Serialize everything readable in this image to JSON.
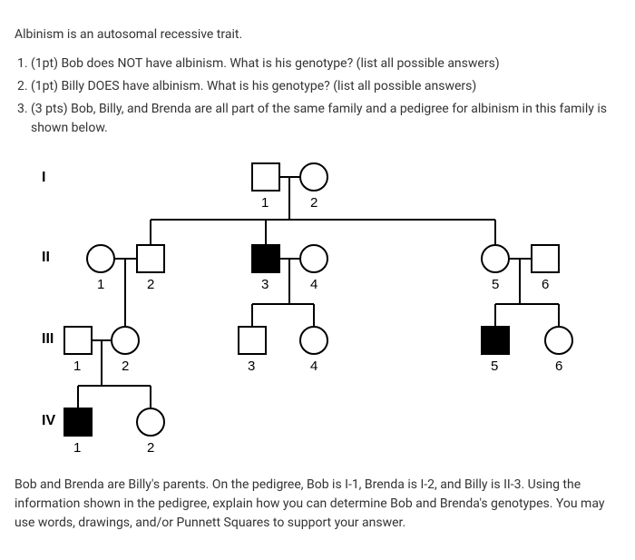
{
  "intro": "Albinism is an autosomal recessive trait.",
  "questions": {
    "q1": "(1pt) Bob does NOT have albinism. What is his genotype? (list all possible answers)",
    "q2": "(1pt) Billy DOES have albinism. What is his genotype? (list all possible answers)",
    "q3": "(3 pts) Bob, Billy, and Brenda are all part of the same family and a pedigree for albinism in this family is shown below."
  },
  "generations": {
    "g1": "I",
    "g2": "II",
    "g3": "III",
    "g4": "IV"
  },
  "labels": {
    "I1": "1",
    "I2": "2",
    "II1": "1",
    "II2": "2",
    "II3": "3",
    "II4": "4",
    "II5": "5",
    "II6": "6",
    "III1": "1",
    "III2": "2",
    "III3": "3",
    "III4": "4",
    "III5": "5",
    "III6": "6",
    "IV1": "1",
    "IV2": "2"
  },
  "chart_data": {
    "type": "pedigree",
    "trait": "Albinism (autosomal recessive)",
    "generations": [
      {
        "label": "I",
        "individuals": [
          {
            "id": "I-1",
            "sex": "male",
            "affected": false
          },
          {
            "id": "I-2",
            "sex": "female",
            "affected": false
          }
        ]
      },
      {
        "label": "II",
        "individuals": [
          {
            "id": "II-1",
            "sex": "female",
            "affected": false
          },
          {
            "id": "II-2",
            "sex": "male",
            "affected": false
          },
          {
            "id": "II-3",
            "sex": "male",
            "affected": true
          },
          {
            "id": "II-4",
            "sex": "female",
            "affected": false
          },
          {
            "id": "II-5",
            "sex": "female",
            "affected": false
          },
          {
            "id": "II-6",
            "sex": "male",
            "affected": false
          }
        ]
      },
      {
        "label": "III",
        "individuals": [
          {
            "id": "III-1",
            "sex": "male",
            "affected": false
          },
          {
            "id": "III-2",
            "sex": "female",
            "affected": false
          },
          {
            "id": "III-3",
            "sex": "male",
            "affected": false
          },
          {
            "id": "III-4",
            "sex": "female",
            "affected": false
          },
          {
            "id": "III-5",
            "sex": "male",
            "affected": true
          },
          {
            "id": "III-6",
            "sex": "female",
            "affected": false
          }
        ]
      },
      {
        "label": "IV",
        "individuals": [
          {
            "id": "IV-1",
            "sex": "male",
            "affected": true
          },
          {
            "id": "IV-2",
            "sex": "female",
            "affected": false
          }
        ]
      }
    ],
    "matings": [
      {
        "parents": [
          "I-1",
          "I-2"
        ],
        "children": [
          "II-2",
          "II-3",
          "II-5"
        ]
      },
      {
        "parents": [
          "II-1",
          "II-2"
        ],
        "children": [
          "III-2"
        ]
      },
      {
        "parents": [
          "II-3",
          "II-4"
        ],
        "children": [
          "III-3",
          "III-4"
        ]
      },
      {
        "parents": [
          "II-5",
          "II-6"
        ],
        "children": [
          "III-5",
          "III-6"
        ]
      },
      {
        "parents": [
          "III-1",
          "III-2"
        ],
        "children": [
          "IV-1",
          "IV-2"
        ]
      }
    ]
  },
  "footer": "Bob and Brenda are Billy's parents. On the pedigree, Bob is I-1, Brenda is I-2, and Billy is II-3. Using the information shown in the pedigree, explain how you can determine Bob and Brenda's genotypes. You may use words, drawings, and/or Punnett Squares to support your answer."
}
